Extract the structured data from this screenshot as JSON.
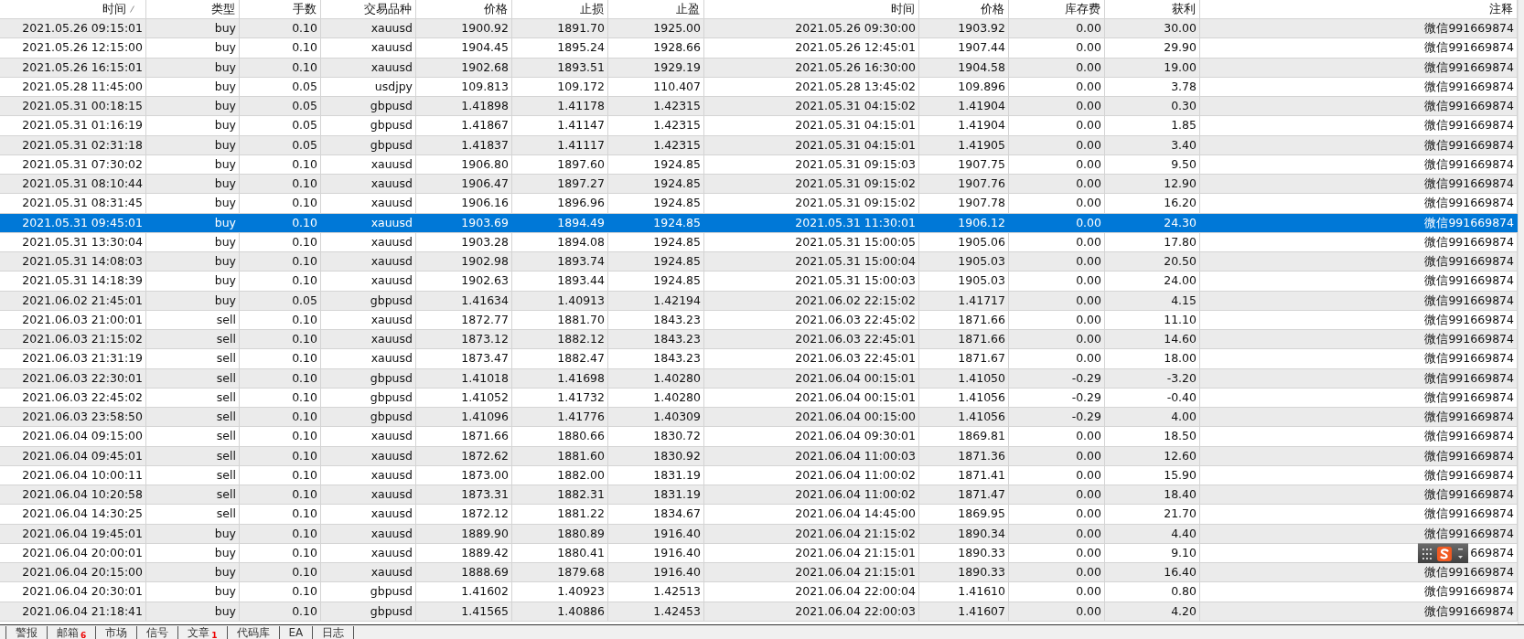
{
  "table": {
    "columns": [
      {
        "label": "时间",
        "sorted": true
      },
      {
        "label": "类型",
        "sorted": false
      },
      {
        "label": "手数",
        "sorted": false
      },
      {
        "label": "交易品种",
        "sorted": false
      },
      {
        "label": "价格",
        "sorted": false
      },
      {
        "label": "止损",
        "sorted": false
      },
      {
        "label": "止盈",
        "sorted": false
      },
      {
        "label": "时间",
        "sorted": false
      },
      {
        "label": "价格",
        "sorted": false
      },
      {
        "label": "库存费",
        "sorted": false
      },
      {
        "label": "获利",
        "sorted": false
      },
      {
        "label": "注释",
        "sorted": false
      }
    ],
    "rows": [
      {
        "selected": false,
        "cells": [
          "2021.05.26 09:15:01",
          "buy",
          "0.10",
          "xauusd",
          "1900.92",
          "1891.70",
          "1925.00",
          "2021.05.26 09:30:00",
          "1903.92",
          "0.00",
          "30.00",
          "微信991669874"
        ]
      },
      {
        "selected": false,
        "cells": [
          "2021.05.26 12:15:00",
          "buy",
          "0.10",
          "xauusd",
          "1904.45",
          "1895.24",
          "1928.66",
          "2021.05.26 12:45:01",
          "1907.44",
          "0.00",
          "29.90",
          "微信991669874"
        ]
      },
      {
        "selected": false,
        "cells": [
          "2021.05.26 16:15:01",
          "buy",
          "0.10",
          "xauusd",
          "1902.68",
          "1893.51",
          "1929.19",
          "2021.05.26 16:30:00",
          "1904.58",
          "0.00",
          "19.00",
          "微信991669874"
        ]
      },
      {
        "selected": false,
        "cells": [
          "2021.05.28 11:45:00",
          "buy",
          "0.05",
          "usdjpy",
          "109.813",
          "109.172",
          "110.407",
          "2021.05.28 13:45:02",
          "109.896",
          "0.00",
          "3.78",
          "微信991669874"
        ]
      },
      {
        "selected": false,
        "cells": [
          "2021.05.31 00:18:15",
          "buy",
          "0.05",
          "gbpusd",
          "1.41898",
          "1.41178",
          "1.42315",
          "2021.05.31 04:15:02",
          "1.41904",
          "0.00",
          "0.30",
          "微信991669874"
        ]
      },
      {
        "selected": false,
        "cells": [
          "2021.05.31 01:16:19",
          "buy",
          "0.05",
          "gbpusd",
          "1.41867",
          "1.41147",
          "1.42315",
          "2021.05.31 04:15:01",
          "1.41904",
          "0.00",
          "1.85",
          "微信991669874"
        ]
      },
      {
        "selected": false,
        "cells": [
          "2021.05.31 02:31:18",
          "buy",
          "0.05",
          "gbpusd",
          "1.41837",
          "1.41117",
          "1.42315",
          "2021.05.31 04:15:01",
          "1.41905",
          "0.00",
          "3.40",
          "微信991669874"
        ]
      },
      {
        "selected": false,
        "cells": [
          "2021.05.31 07:30:02",
          "buy",
          "0.10",
          "xauusd",
          "1906.80",
          "1897.60",
          "1924.85",
          "2021.05.31 09:15:03",
          "1907.75",
          "0.00",
          "9.50",
          "微信991669874"
        ]
      },
      {
        "selected": false,
        "cells": [
          "2021.05.31 08:10:44",
          "buy",
          "0.10",
          "xauusd",
          "1906.47",
          "1897.27",
          "1924.85",
          "2021.05.31 09:15:02",
          "1907.76",
          "0.00",
          "12.90",
          "微信991669874"
        ]
      },
      {
        "selected": false,
        "cells": [
          "2021.05.31 08:31:45",
          "buy",
          "0.10",
          "xauusd",
          "1906.16",
          "1896.96",
          "1924.85",
          "2021.05.31 09:15:02",
          "1907.78",
          "0.00",
          "16.20",
          "微信991669874"
        ]
      },
      {
        "selected": true,
        "cells": [
          "2021.05.31 09:45:01",
          "buy",
          "0.10",
          "xauusd",
          "1903.69",
          "1894.49",
          "1924.85",
          "2021.05.31 11:30:01",
          "1906.12",
          "0.00",
          "24.30",
          "微信991669874"
        ]
      },
      {
        "selected": false,
        "cells": [
          "2021.05.31 13:30:04",
          "buy",
          "0.10",
          "xauusd",
          "1903.28",
          "1894.08",
          "1924.85",
          "2021.05.31 15:00:05",
          "1905.06",
          "0.00",
          "17.80",
          "微信991669874"
        ]
      },
      {
        "selected": false,
        "cells": [
          "2021.05.31 14:08:03",
          "buy",
          "0.10",
          "xauusd",
          "1902.98",
          "1893.74",
          "1924.85",
          "2021.05.31 15:00:04",
          "1905.03",
          "0.00",
          "20.50",
          "微信991669874"
        ]
      },
      {
        "selected": false,
        "cells": [
          "2021.05.31 14:18:39",
          "buy",
          "0.10",
          "xauusd",
          "1902.63",
          "1893.44",
          "1924.85",
          "2021.05.31 15:00:03",
          "1905.03",
          "0.00",
          "24.00",
          "微信991669874"
        ]
      },
      {
        "selected": false,
        "cells": [
          "2021.06.02 21:45:01",
          "buy",
          "0.05",
          "gbpusd",
          "1.41634",
          "1.40913",
          "1.42194",
          "2021.06.02 22:15:02",
          "1.41717",
          "0.00",
          "4.15",
          "微信991669874"
        ]
      },
      {
        "selected": false,
        "cells": [
          "2021.06.03 21:00:01",
          "sell",
          "0.10",
          "xauusd",
          "1872.77",
          "1881.70",
          "1843.23",
          "2021.06.03 22:45:02",
          "1871.66",
          "0.00",
          "11.10",
          "微信991669874"
        ]
      },
      {
        "selected": false,
        "cells": [
          "2021.06.03 21:15:02",
          "sell",
          "0.10",
          "xauusd",
          "1873.12",
          "1882.12",
          "1843.23",
          "2021.06.03 22:45:01",
          "1871.66",
          "0.00",
          "14.60",
          "微信991669874"
        ]
      },
      {
        "selected": false,
        "cells": [
          "2021.06.03 21:31:19",
          "sell",
          "0.10",
          "xauusd",
          "1873.47",
          "1882.47",
          "1843.23",
          "2021.06.03 22:45:01",
          "1871.67",
          "0.00",
          "18.00",
          "微信991669874"
        ]
      },
      {
        "selected": false,
        "cells": [
          "2021.06.03 22:30:01",
          "sell",
          "0.10",
          "gbpusd",
          "1.41018",
          "1.41698",
          "1.40280",
          "2021.06.04 00:15:01",
          "1.41050",
          "-0.29",
          "-3.20",
          "微信991669874"
        ]
      },
      {
        "selected": false,
        "cells": [
          "2021.06.03 22:45:02",
          "sell",
          "0.10",
          "gbpusd",
          "1.41052",
          "1.41732",
          "1.40280",
          "2021.06.04 00:15:01",
          "1.41056",
          "-0.29",
          "-0.40",
          "微信991669874"
        ]
      },
      {
        "selected": false,
        "cells": [
          "2021.06.03 23:58:50",
          "sell",
          "0.10",
          "gbpusd",
          "1.41096",
          "1.41776",
          "1.40309",
          "2021.06.04 00:15:00",
          "1.41056",
          "-0.29",
          "4.00",
          "微信991669874"
        ]
      },
      {
        "selected": false,
        "cells": [
          "2021.06.04 09:15:00",
          "sell",
          "0.10",
          "xauusd",
          "1871.66",
          "1880.66",
          "1830.72",
          "2021.06.04 09:30:01",
          "1869.81",
          "0.00",
          "18.50",
          "微信991669874"
        ]
      },
      {
        "selected": false,
        "cells": [
          "2021.06.04 09:45:01",
          "sell",
          "0.10",
          "xauusd",
          "1872.62",
          "1881.60",
          "1830.92",
          "2021.06.04 11:00:03",
          "1871.36",
          "0.00",
          "12.60",
          "微信991669874"
        ]
      },
      {
        "selected": false,
        "cells": [
          "2021.06.04 10:00:11",
          "sell",
          "0.10",
          "xauusd",
          "1873.00",
          "1882.00",
          "1831.19",
          "2021.06.04 11:00:02",
          "1871.41",
          "0.00",
          "15.90",
          "微信991669874"
        ]
      },
      {
        "selected": false,
        "cells": [
          "2021.06.04 10:20:58",
          "sell",
          "0.10",
          "xauusd",
          "1873.31",
          "1882.31",
          "1831.19",
          "2021.06.04 11:00:02",
          "1871.47",
          "0.00",
          "18.40",
          "微信991669874"
        ]
      },
      {
        "selected": false,
        "cells": [
          "2021.06.04 14:30:25",
          "sell",
          "0.10",
          "xauusd",
          "1872.12",
          "1881.22",
          "1834.67",
          "2021.06.04 14:45:00",
          "1869.95",
          "0.00",
          "21.70",
          "微信991669874"
        ]
      },
      {
        "selected": false,
        "cells": [
          "2021.06.04 19:45:01",
          "buy",
          "0.10",
          "xauusd",
          "1889.90",
          "1880.89",
          "1916.40",
          "2021.06.04 21:15:02",
          "1890.34",
          "0.00",
          "4.40",
          "微信991669874"
        ]
      },
      {
        "selected": false,
        "cells": [
          "2021.06.04 20:00:01",
          "buy",
          "0.10",
          "xauusd",
          "1889.42",
          "1880.41",
          "1916.40",
          "2021.06.04 21:15:01",
          "1890.33",
          "0.00",
          "9.10",
          "669874"
        ]
      },
      {
        "selected": false,
        "cells": [
          "2021.06.04 20:15:00",
          "buy",
          "0.10",
          "xauusd",
          "1888.69",
          "1879.68",
          "1916.40",
          "2021.06.04 21:15:01",
          "1890.33",
          "0.00",
          "16.40",
          "微信991669874"
        ]
      },
      {
        "selected": false,
        "cells": [
          "2021.06.04 20:30:01",
          "buy",
          "0.10",
          "gbpusd",
          "1.41602",
          "1.40923",
          "1.42513",
          "2021.06.04 22:00:04",
          "1.41610",
          "0.00",
          "0.80",
          "微信991669874"
        ]
      },
      {
        "selected": false,
        "cells": [
          "2021.06.04 21:18:41",
          "buy",
          "0.10",
          "gbpusd",
          "1.41565",
          "1.40886",
          "1.42453",
          "2021.06.04 22:00:03",
          "1.41607",
          "0.00",
          "4.20",
          "微信991669874"
        ]
      }
    ]
  },
  "tabs": [
    {
      "label": "警报"
    },
    {
      "label": "邮箱",
      "badge": "6"
    },
    {
      "label": "市场"
    },
    {
      "label": "信号"
    },
    {
      "label": "文章",
      "badge": "1"
    },
    {
      "label": "代码库"
    },
    {
      "label": "EA"
    },
    {
      "label": "日志"
    }
  ]
}
